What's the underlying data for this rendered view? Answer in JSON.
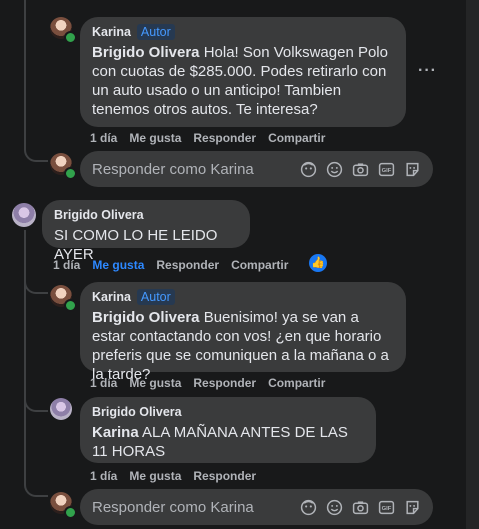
{
  "comments": [
    {
      "author": "Karina",
      "badge": "Autor",
      "mention": "Brigido Olivera",
      "text": " Hola! Son Volkswagen Polo con cuotas de $285.000. Podes retirarlo con un auto usado o un anticipo! Tambien tenemos otros autos. Te interesa?",
      "time": "1 día",
      "like": "Me gusta",
      "reply": "Responder",
      "share": "Compartir"
    },
    {
      "author": "Brigido Olivera",
      "text": "SI COMO LO HE LEIDO AYER",
      "time": "1 día",
      "like": "Me gusta",
      "reply": "Responder",
      "share": "Compartir",
      "reaction_icon": "thumbs-up-icon"
    },
    {
      "author": "Karina",
      "badge": "Autor",
      "mention": "Brigido Olivera",
      "text": " Buenisimo! ya se van a estar contactando con vos! ¿en que horario preferis que se comuniquen a la mañana o a la tarde?",
      "time": "1 día",
      "like": "Me gusta",
      "reply": "Responder",
      "share": "Compartir"
    },
    {
      "author": "Brigido Olivera",
      "mention": "Karina",
      "text": " ALA MAÑANA ANTES DE LAS 11 HORAS",
      "time": "1 día",
      "like": "Me gusta",
      "reply": "Responder"
    }
  ],
  "reply_box": {
    "placeholder": "Responder como Karina",
    "icons": [
      "avatar-sticker-icon",
      "emoji-icon",
      "camera-icon",
      "gif-icon",
      "sticker-icon"
    ]
  },
  "more_menu": "···",
  "colors": {
    "like_active": "#2d88ff",
    "bubble": "#3a3b3c",
    "background": "#18191a",
    "badge_text": "#4599ff"
  }
}
